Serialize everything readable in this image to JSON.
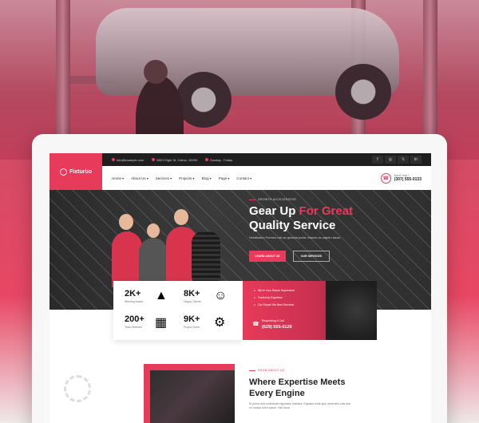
{
  "topbar": {
    "email": "info@example.com",
    "address": "5891 Elgin St. Celina, 10299",
    "hours": "Sunday - Friday",
    "socials": [
      "f",
      "◎",
      "𝕏",
      "in"
    ]
  },
  "brand": {
    "name": "Fixturbo",
    "color": "#e83a5a"
  },
  "nav": {
    "items": [
      "Home",
      "About Us",
      "Services",
      "Projects",
      "Blog",
      "Page",
      "Contact"
    ],
    "call_label": "Need Help?",
    "call_number": "(307) 555-0133"
  },
  "hero": {
    "tag": "GROWTH ACCELERATOR",
    "title_plain": "Gear Up",
    "title_accent": "For Great",
    "title_line2": "Quality Service",
    "subtitle": "Vestibulum Formus nisi ac gravida porta. Mauris ac sapien lacus",
    "btn_primary": "LEARN ABOUT US",
    "btn_secondary": "OUR SERVICES"
  },
  "stats": [
    {
      "value": "2K+",
      "label": "Winning Award",
      "icon": "award-icon"
    },
    {
      "value": "8K+",
      "label": "Happy Clients",
      "icon": "smile-icon"
    },
    {
      "value": "200+",
      "label": "Team Member",
      "icon": "team-icon"
    },
    {
      "value": "9K+",
      "label": "Project Done",
      "icon": "project-icon"
    }
  ],
  "features": {
    "items": [
      "We're Your Repair Superstore",
      "Fueled by Expertise",
      "Car Repair We Best Services"
    ],
    "phone_label": "Requesting A Call",
    "phone_number": "(629) 555-0129"
  },
  "about": {
    "tag": "KNOW ABOUT US",
    "title": "Where Expertise Meets Every Engine",
    "text": "Et purus duis sollicitudin dignissim habitant. Egestas nulla quis venenatis cras sed eu massa loren ipsum. Nisi lacus"
  }
}
